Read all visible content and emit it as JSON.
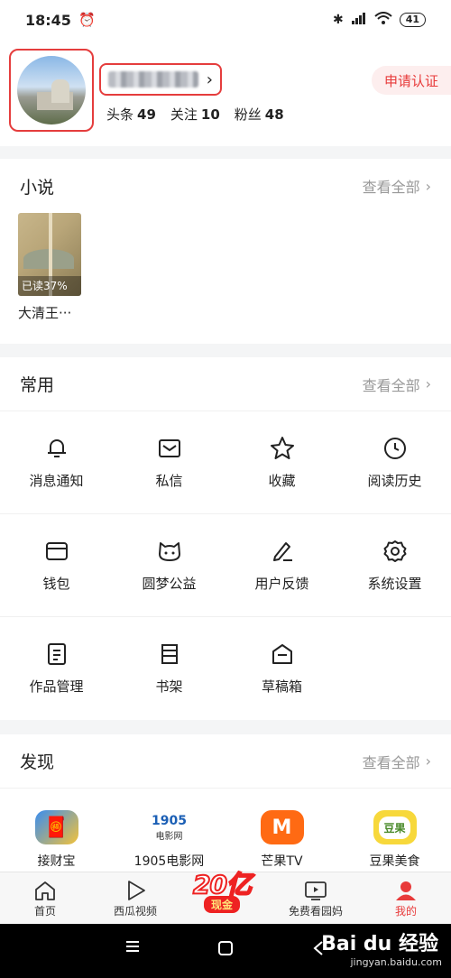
{
  "status": {
    "time": "18:45",
    "battery": "41"
  },
  "profile": {
    "stats": [
      {
        "label": "头条",
        "value": "49"
      },
      {
        "label": "关注",
        "value": "10"
      },
      {
        "label": "粉丝",
        "value": "48"
      }
    ],
    "apply_label": "申请认证"
  },
  "novel_section": {
    "title": "小说",
    "more": "查看全部",
    "books": [
      {
        "title": "大清王···",
        "progress": "已读37%"
      }
    ]
  },
  "common_section": {
    "title": "常用",
    "more": "查看全部",
    "items": [
      {
        "label": "消息通知",
        "icon": "bell-icon"
      },
      {
        "label": "私信",
        "icon": "mail-icon"
      },
      {
        "label": "收藏",
        "icon": "star-icon"
      },
      {
        "label": "阅读历史",
        "icon": "clock-icon"
      },
      {
        "label": "钱包",
        "icon": "wallet-icon"
      },
      {
        "label": "圆梦公益",
        "icon": "charity-icon"
      },
      {
        "label": "用户反馈",
        "icon": "feedback-icon"
      },
      {
        "label": "系统设置",
        "icon": "gear-icon"
      },
      {
        "label": "作品管理",
        "icon": "works-icon"
      },
      {
        "label": "书架",
        "icon": "bookshelf-icon"
      },
      {
        "label": "草稿箱",
        "icon": "drafts-icon"
      }
    ]
  },
  "discover_section": {
    "title": "发现",
    "more": "查看全部",
    "apps": [
      {
        "label": "接财宝",
        "icon": "caishen-app-icon"
      },
      {
        "label": "1905电影网",
        "icon": "1905-app-icon",
        "icon_text": "1905",
        "icon_sub": "电影网"
      },
      {
        "label": "芒果TV",
        "icon": "mango-tv-app-icon"
      },
      {
        "label": "豆果美食",
        "icon": "douguo-app-icon",
        "icon_text": "豆果"
      }
    ]
  },
  "tabbar": {
    "tabs": [
      {
        "label": "首页",
        "icon": "home-icon"
      },
      {
        "label": "西瓜视频",
        "icon": "play-icon"
      },
      {
        "label": "免费看园妈",
        "icon": "tv-icon"
      },
      {
        "label": "我的",
        "icon": "user-icon"
      }
    ],
    "promo_big": "20亿",
    "promo_small": "现金"
  },
  "watermark": {
    "brand": "Bai du 经验",
    "url": "jingyan.baidu.com"
  },
  "colors": {
    "accent": "#e83a3a",
    "highlight_box": "#e53d3d"
  }
}
